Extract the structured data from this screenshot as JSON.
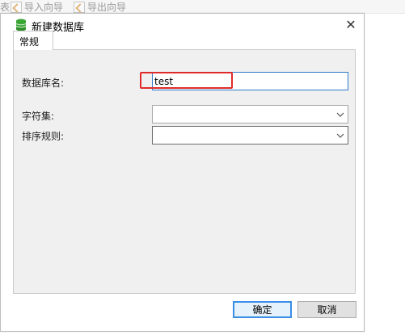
{
  "background_toolbar": {
    "edge_text": "表",
    "import_wizard": "导入向导",
    "export_wizard": "导出向导"
  },
  "dialog": {
    "title": "新建数据库",
    "close_symbol": "✕",
    "tab_general": "常规",
    "fields": {
      "database_name_label": "数据库名:",
      "database_name_value": "test",
      "charset_label": "字符集:",
      "charset_value": "",
      "collation_label": "排序规则:",
      "collation_value": ""
    },
    "buttons": {
      "ok": "确定",
      "cancel": "取消"
    }
  },
  "colors": {
    "highlight": "#e02a2a",
    "active_border": "#2f78c8",
    "db_icon": "#3aa635"
  }
}
